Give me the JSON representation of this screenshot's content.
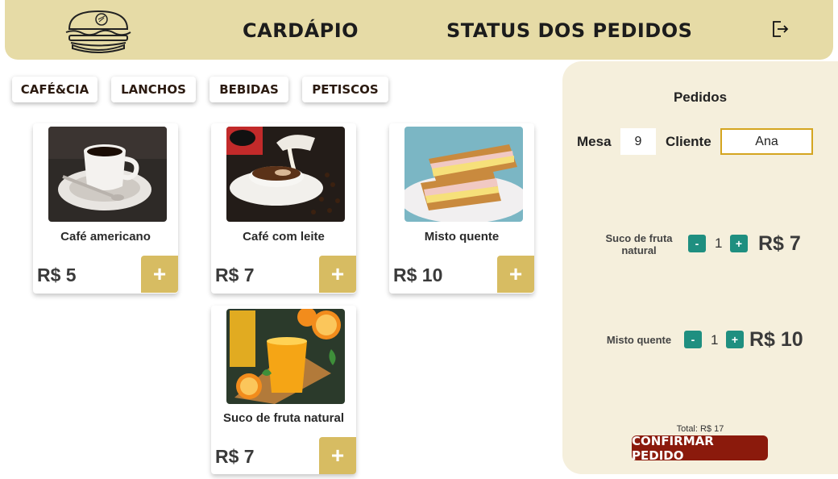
{
  "header": {
    "nav": {
      "menu": "CARDÁPIO",
      "orders_status": "STATUS DOS PEDIDOS"
    },
    "logout_icon": "logout-icon",
    "logo_icon": "burger-logo-icon"
  },
  "categories": [
    "CAFÉ&CIA",
    "LANCHOS",
    "BEBIDAS",
    "PETISCOS"
  ],
  "products": [
    {
      "name": "Café americano",
      "price": "R$ 5",
      "add_label": "+"
    },
    {
      "name": "Café com leite",
      "price": "R$ 7",
      "add_label": "+"
    },
    {
      "name": "Misto quente",
      "price": "R$ 10",
      "add_label": "+"
    },
    {
      "name": "Suco de fruta natural",
      "price": "R$ 7",
      "add_label": "+"
    }
  ],
  "order": {
    "title": "Pedidos",
    "mesa_label": "Mesa",
    "mesa_value": "9",
    "cliente_label": "Cliente",
    "cliente_value": "Ana",
    "items": [
      {
        "name": "Suco de fruta natural",
        "qty": "1",
        "price": "R$ 7",
        "minus": "-",
        "plus": "+"
      },
      {
        "name": "Misto quente",
        "qty": "1",
        "price": "R$ 10",
        "minus": "-",
        "plus": "+"
      }
    ],
    "total": "Total: R$ 17",
    "confirm_label": "CONFIRMAR PEDIDO"
  },
  "colors": {
    "header_bg": "#e6dba6",
    "panel_bg": "#f5efdc",
    "add_button": "#d7bc62",
    "qty_button": "#1f8f80",
    "confirm_button": "#8b1a0c"
  }
}
